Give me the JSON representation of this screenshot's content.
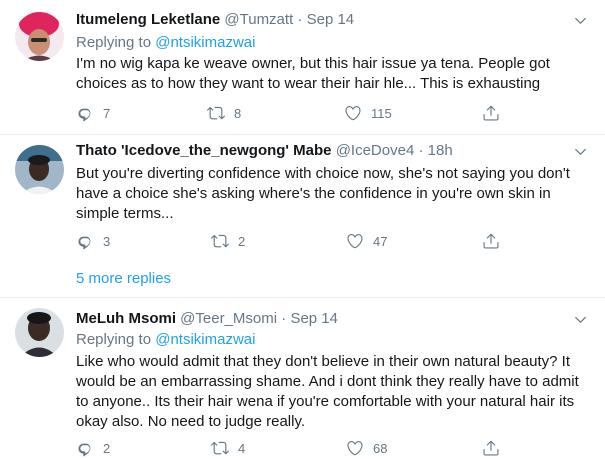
{
  "tweets": [
    {
      "name": "Itumeleng Leketlane",
      "handle": "@Tumzatt",
      "separator": "·",
      "time": "Sep 14",
      "replying_prefix": "Replying to",
      "replying_to": "@ntsikimazwai",
      "text_lines": [
        "I'm no wig kapa ke weave owner, but this hair issue ya tena. People got",
        "choices as to how they want to wear their hair hle... This is exhausting"
      ],
      "replies": "7",
      "retweets": "8",
      "likes": "115"
    },
    {
      "name": "Thato 'Icedove_the_newgong' Mabe",
      "handle": "@IceDove4",
      "separator": "·",
      "time": "18h",
      "text_lines": [
        "But you're diverting confidence with choice now, she's not saying you don't",
        "have a choice she's asking where's the confidence in you're own skin in",
        "simple terms..."
      ],
      "replies": "3",
      "retweets": "2",
      "likes": "47"
    },
    {
      "name": "MeLuh Msomi",
      "handle": "@Teer_Msomi",
      "separator": "·",
      "time": "Sep 14",
      "replying_prefix": "Replying to",
      "replying_to": "@ntsikimazwai",
      "text_lines": [
        "Like who would admit that they don't believe in their own natural beauty? It",
        "would be an embarrassing shame. And i dont think they really have to admit",
        "to anyone.. Its their hair wena if you're comfortable with your natural hair its",
        "okay also. No need to judge really."
      ],
      "replies": "2",
      "retweets": "4",
      "likes": "68"
    }
  ],
  "more_replies": "5 more replies",
  "icons": {
    "reply": "reply-icon",
    "retweet": "retweet-icon",
    "like": "heart-icon",
    "share": "share-icon",
    "caret": "chevron-down-icon"
  },
  "colors": {
    "text": "#14171a",
    "muted": "#657786",
    "link": "#1da1f2",
    "divider": "#e6ecf0"
  }
}
